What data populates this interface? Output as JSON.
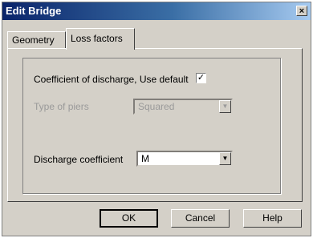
{
  "window": {
    "title": "Edit Bridge",
    "close_glyph": "×"
  },
  "tabs": [
    {
      "label": "Geometry",
      "active": false
    },
    {
      "label": "Loss factors",
      "active": true
    }
  ],
  "loss_factors": {
    "use_default_label": "Coefficient of discharge, Use default",
    "use_default_checked": true,
    "check_glyph": "✓",
    "piers_label": "Type of piers",
    "piers_value": "Squared",
    "piers_disabled": true,
    "discharge_label": "Discharge coefficient",
    "discharge_value": "M",
    "dropdown_glyph": "▼"
  },
  "buttons": {
    "ok": "OK",
    "cancel": "Cancel",
    "help": "Help"
  }
}
